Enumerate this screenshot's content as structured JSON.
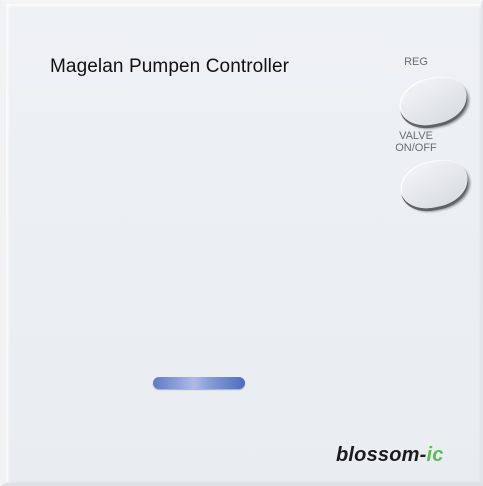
{
  "device": {
    "title": "Magelan Pumpen Controller",
    "buttons": {
      "reg_label": "REG",
      "valve_label": "VALVE\nON/OFF"
    },
    "led": {
      "color": "#7f95d6",
      "state": "on"
    },
    "brand": {
      "main": "blossom-",
      "accent": "ic",
      "accent_color": "#5bbd53"
    }
  }
}
